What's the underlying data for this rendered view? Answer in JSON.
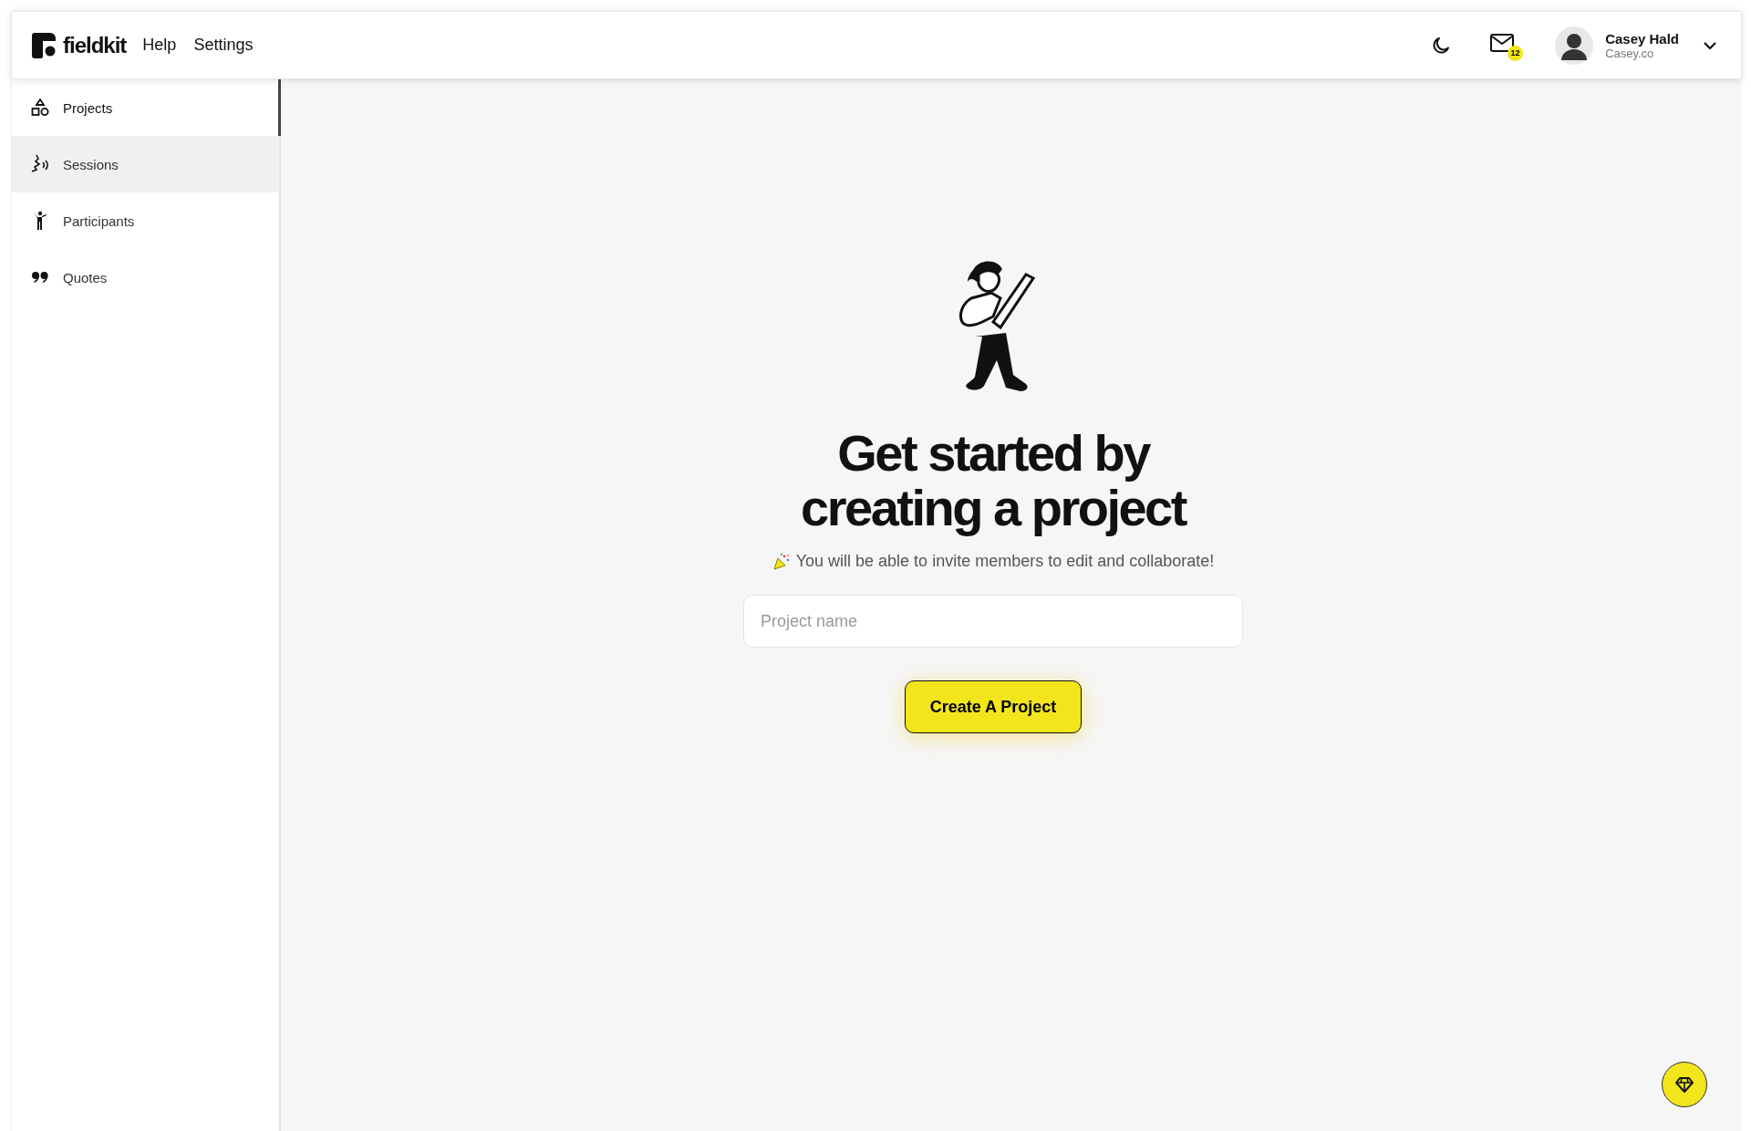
{
  "header": {
    "logo_text": "fieldkit",
    "nav": [
      "Help",
      "Settings"
    ],
    "notifications_count": "12",
    "user": {
      "name": "Casey Hald",
      "subtitle": "Casey.co"
    }
  },
  "sidebar": {
    "items": [
      {
        "label": "Projects",
        "selected": true,
        "hovered": false
      },
      {
        "label": "Sessions",
        "selected": false,
        "hovered": true
      },
      {
        "label": "Participants",
        "selected": false,
        "hovered": false
      },
      {
        "label": "Quotes",
        "selected": false,
        "hovered": false
      }
    ]
  },
  "empty_state": {
    "title_lines": [
      "Get started by",
      "creating a project"
    ],
    "subtitle": "You will be able to invite members to edit and collaborate!",
    "input": {
      "placeholder": "Project name"
    },
    "button": "Create A Project"
  }
}
